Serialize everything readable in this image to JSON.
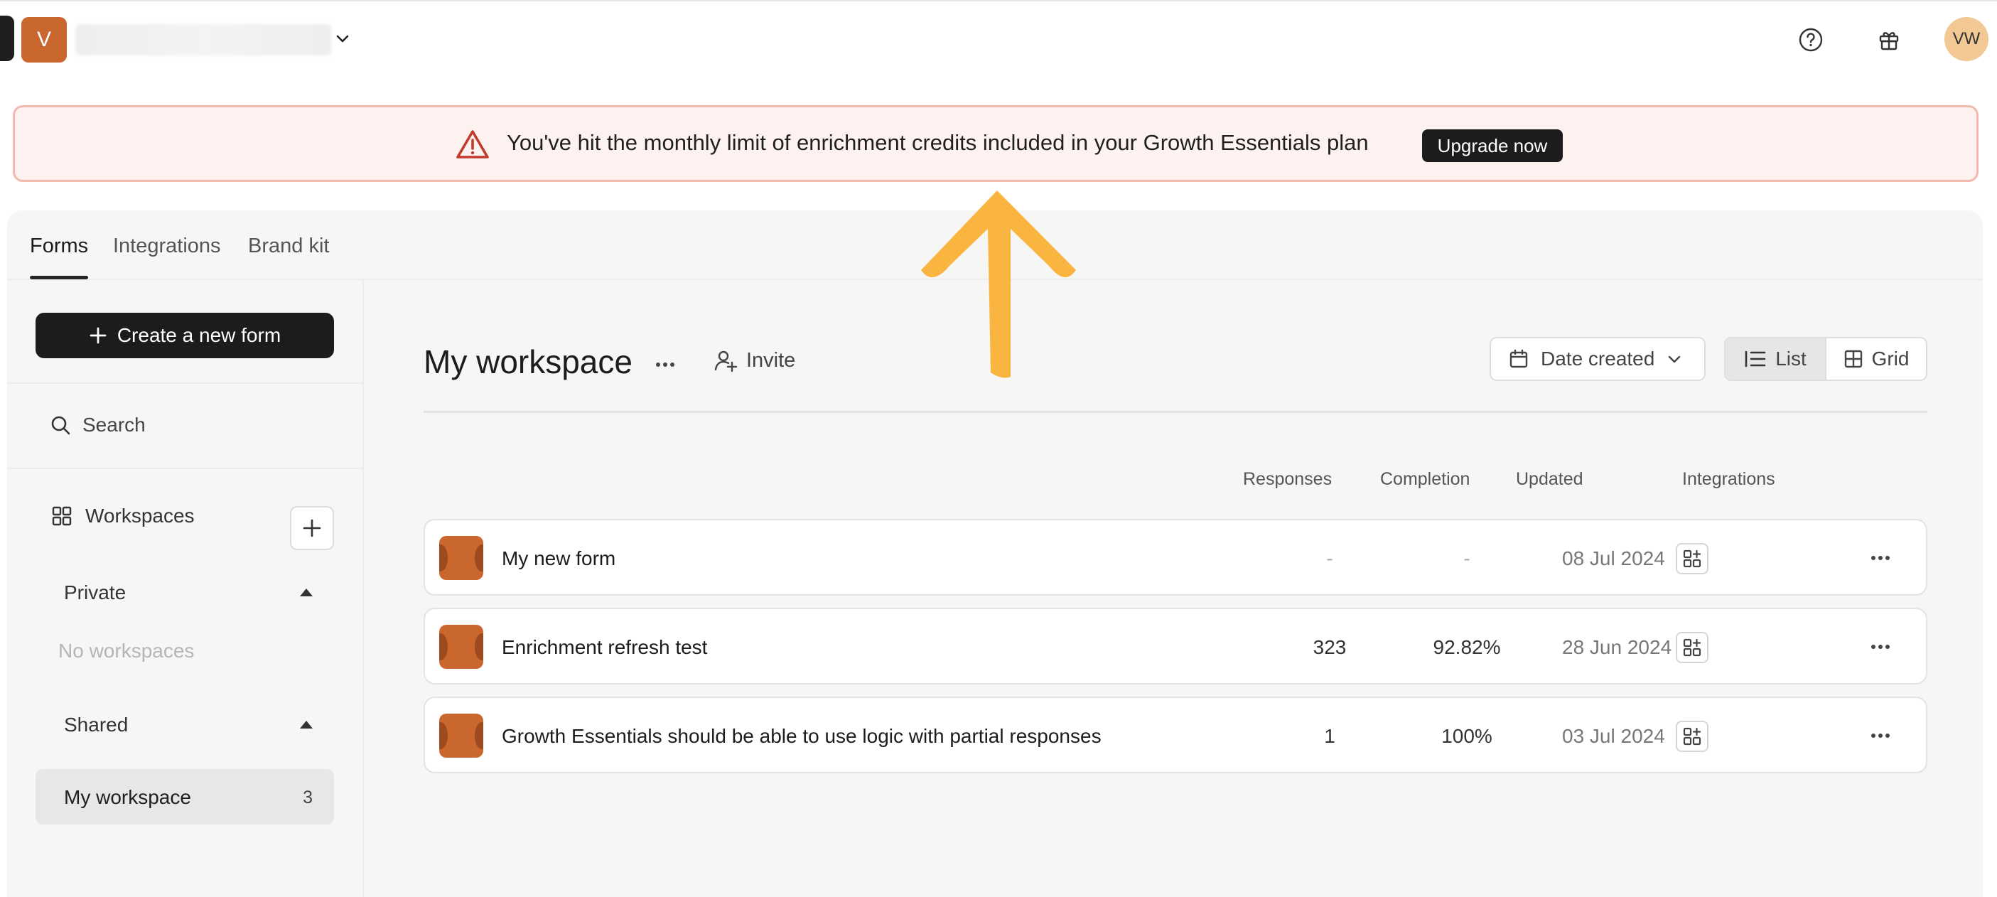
{
  "header": {
    "org_initial": "V",
    "user_initials": "VW"
  },
  "alert": {
    "message": "You've hit the monthly limit of enrichment credits included in your Growth Essentials plan",
    "cta": "Upgrade now"
  },
  "tabs": [
    {
      "label": "Forms",
      "active": true
    },
    {
      "label": "Integrations",
      "active": false
    },
    {
      "label": "Brand kit",
      "active": false
    }
  ],
  "sidebar": {
    "create_label": "Create a new form",
    "search_placeholder": "Search",
    "workspaces_label": "Workspaces",
    "private_label": "Private",
    "no_workspaces": "No workspaces",
    "shared_label": "Shared",
    "shared_items": [
      {
        "label": "My workspace",
        "count": "3"
      }
    ]
  },
  "main": {
    "title": "My workspace",
    "invite_label": "Invite",
    "sort_label": "Date created",
    "view_list": "List",
    "view_grid": "Grid",
    "columns": {
      "responses": "Responses",
      "completion": "Completion",
      "updated": "Updated",
      "integrations": "Integrations"
    },
    "forms": [
      {
        "name": "My new form",
        "responses": "-",
        "completion": "-",
        "updated": "08 Jul 2024"
      },
      {
        "name": "Enrichment refresh test",
        "responses": "323",
        "completion": "92.82%",
        "updated": "28 Jun 2024"
      },
      {
        "name": "Growth Essentials should be able to use logic with partial responses",
        "responses": "1",
        "completion": "100%",
        "updated": "03 Jul 2024"
      }
    ]
  },
  "colors": {
    "accent_dark": "#1c1c1c",
    "brand_orange": "#c9672f",
    "alert_bg": "#fdf2f0",
    "alert_border": "#f3b9ae",
    "alert_icon": "#c23a2b",
    "annotation_arrow": "#f9b53f",
    "avatar_bg": "#f2c894"
  }
}
